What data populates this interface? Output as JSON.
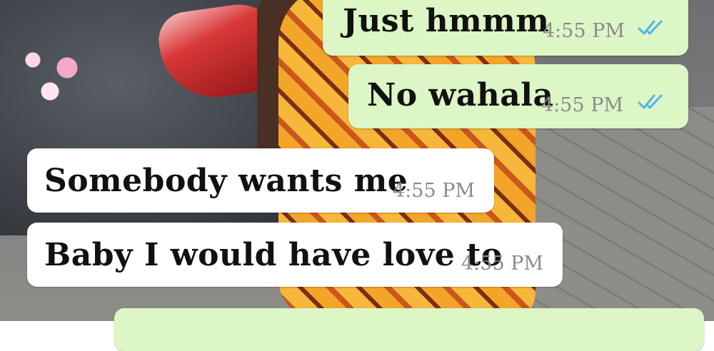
{
  "messages": [
    {
      "direction": "outgoing",
      "text": "Just hmmm",
      "time": "4:55 PM",
      "status": "read"
    },
    {
      "direction": "outgoing",
      "text": "No wahala",
      "time": "4:55 PM",
      "status": "read"
    },
    {
      "direction": "incoming",
      "text": "Somebody wants me",
      "time": "4:55 PM"
    },
    {
      "direction": "incoming",
      "text": "Baby I would have love to",
      "time": "4:55 PM"
    }
  ],
  "colors": {
    "outgoing_bubble": "#dcf6c5",
    "incoming_bubble": "#ffffff",
    "read_ticks": "#4fb6ec",
    "timestamp": "#8a8a8a"
  },
  "icons": {
    "read_receipt": "double-check-icon"
  }
}
